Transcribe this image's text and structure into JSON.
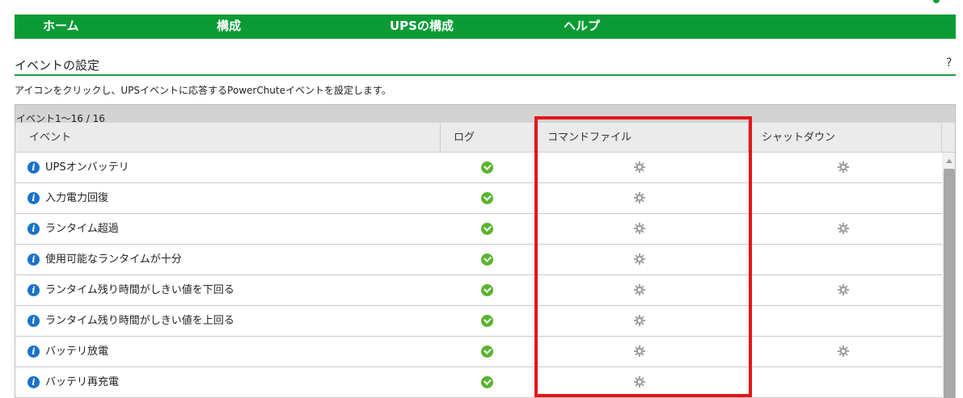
{
  "nav": {
    "items": [
      "ホーム",
      "構成",
      "UPSの構成",
      "ヘルプ"
    ],
    "bg_color": "#0a9b35"
  },
  "section": {
    "title": "イベントの設定",
    "help": "?",
    "description": "アイコンをクリックし、UPSイベントに応答するPowerChuteイベントを設定します。"
  },
  "grid": {
    "pager": "イベント1〜16 / 16",
    "columns": [
      "イベント",
      "ログ",
      "コマンドファイル",
      "シャットダウン"
    ],
    "rows": [
      {
        "event": "UPSオンバッテリ",
        "log": true,
        "command_file": true,
        "shutdown": true
      },
      {
        "event": "入力電力回復",
        "log": true,
        "command_file": true,
        "shutdown": false
      },
      {
        "event": "ランタイム超過",
        "log": true,
        "command_file": true,
        "shutdown": true
      },
      {
        "event": "使用可能なランタイムが十分",
        "log": true,
        "command_file": true,
        "shutdown": false
      },
      {
        "event": "ランタイム残り時間がしきい値を下回る",
        "log": true,
        "command_file": true,
        "shutdown": true
      },
      {
        "event": "ランタイム残り時間がしきい値を上回る",
        "log": true,
        "command_file": true,
        "shutdown": false
      },
      {
        "event": "バッテリ放電",
        "log": true,
        "command_file": true,
        "shutdown": true
      },
      {
        "event": "バッテリ再充電",
        "log": true,
        "command_file": true,
        "shutdown": false
      }
    ],
    "icons": {
      "info": "info-icon",
      "log": "check-circle-icon",
      "config": "gear-icon"
    },
    "colors": {
      "info": "#1a73c8",
      "check": "#5ab42e",
      "gear": "#9a9a9a",
      "highlight": "#e3151a"
    }
  }
}
